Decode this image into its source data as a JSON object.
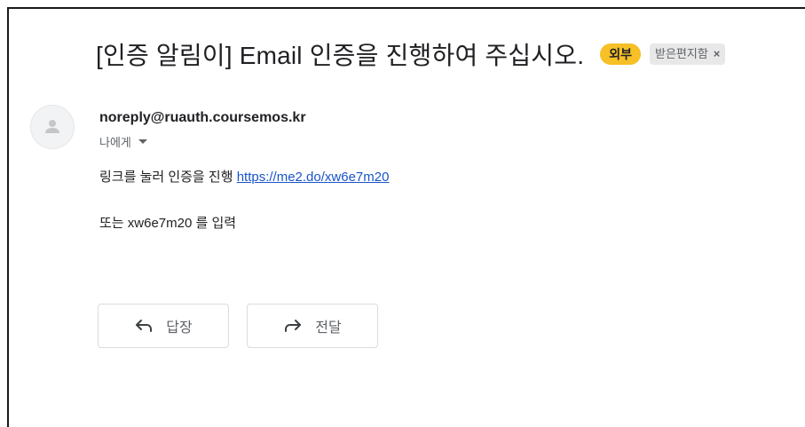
{
  "email": {
    "subject": "[인증 알림이] Email 인증을 진행하여 주십시오.",
    "labels": {
      "external": "외부",
      "inbox": "받은편지함",
      "inbox_remove": "×"
    },
    "sender": "noreply@ruauth.coursemos.kr",
    "recipient": "나에게",
    "body": {
      "line1_prefix": "링크를 눌러 인증을 진행",
      "link": "https://me2.do/xw6e7m20",
      "line2": "또는 xw6e7m20 를 입력"
    }
  },
  "actions": {
    "reply_label": "답장",
    "forward_label": "전달"
  },
  "icons": {
    "avatar": "person-icon",
    "recipient_dropdown": "caret-down-icon",
    "reply": "reply-arrow-icon",
    "forward": "forward-arrow-icon"
  },
  "colors": {
    "external_label_bg": "#f6c026",
    "inbox_label_bg": "#e8e8e8",
    "link": "#1a55c8"
  }
}
